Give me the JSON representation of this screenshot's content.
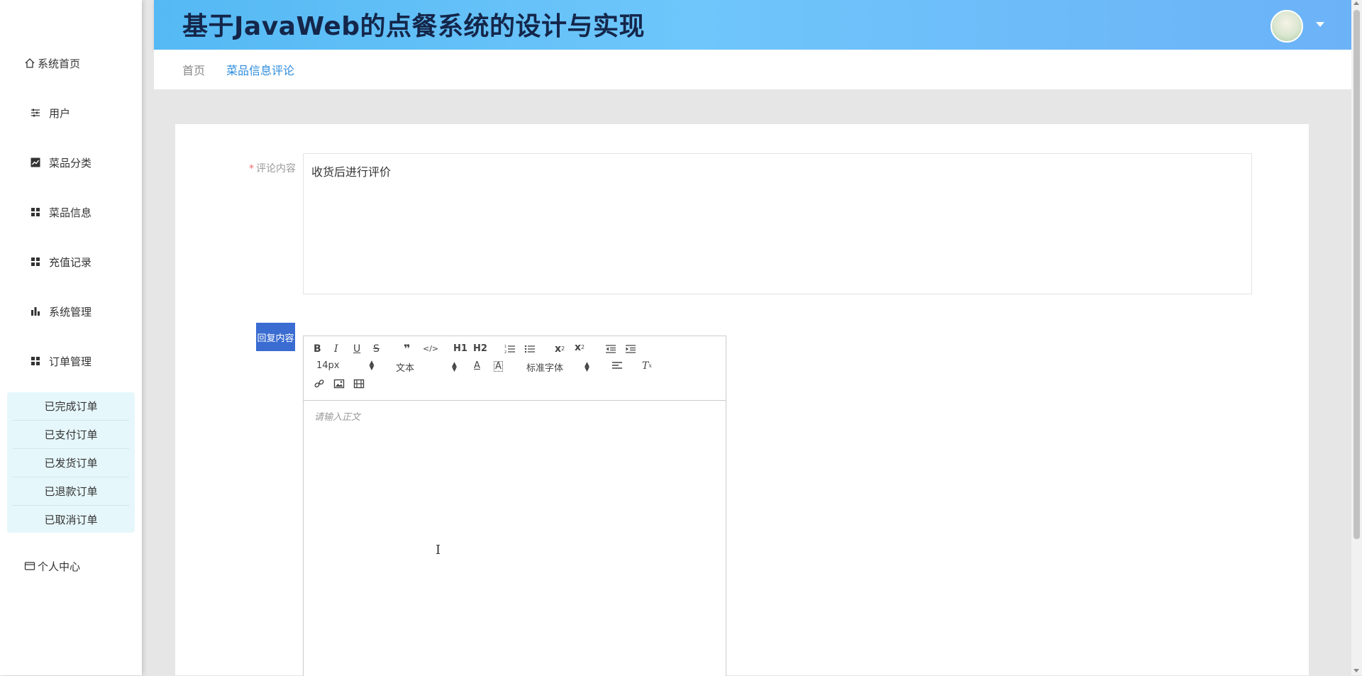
{
  "header": {
    "title": "基于JavaWeb的点餐系统的设计与实现"
  },
  "breadcrumb": {
    "home": "首页",
    "current": "菜品信息评论"
  },
  "sidebar": {
    "items": [
      {
        "label": "系统首页",
        "icon": "home-icon"
      },
      {
        "label": "用户",
        "icon": "sliders-icon"
      },
      {
        "label": "菜品分类",
        "icon": "chart-icon"
      },
      {
        "label": "菜品信息",
        "icon": "grid-icon"
      },
      {
        "label": "充值记录",
        "icon": "grid-icon"
      },
      {
        "label": "系统管理",
        "icon": "bar-chart-icon"
      },
      {
        "label": "订单管理",
        "icon": "grid-icon"
      }
    ],
    "order_submenu": [
      "已完成订单",
      "已支付订单",
      "已发货订单",
      "已退款订单",
      "已取消订单"
    ],
    "personal": {
      "label": "个人中心",
      "icon": "card-icon"
    }
  },
  "form": {
    "comment_label": "评论内容",
    "required_mark": "*",
    "comment_value": "收货后进行评价",
    "reply_label": "回复内容"
  },
  "editor": {
    "font_size": "14px",
    "header_type": "文本",
    "font_family": "标准字体",
    "placeholder": "请输入正文",
    "h1": "H1",
    "h2": "H2",
    "tool_icons": [
      "bold-icon",
      "italic-icon",
      "underline-icon",
      "strikethrough-icon",
      "blockquote-icon",
      "code-icon",
      "h1-icon",
      "h2-icon",
      "ordered-list-icon",
      "bullet-list-icon",
      "subscript-icon",
      "superscript-icon",
      "outdent-icon",
      "indent-icon",
      "font-color-icon",
      "background-color-icon",
      "align-icon",
      "clear-format-icon",
      "link-icon",
      "image-icon",
      "video-icon"
    ]
  },
  "colors": {
    "header_gradient_start": "#55b9f3",
    "header_title": "#14264a",
    "breadcrumb_active": "#2d8cdc",
    "reply_label_bg": "#3a6cd2",
    "submenu_bg": "#e6f7fb",
    "required": "#f56c6c"
  }
}
